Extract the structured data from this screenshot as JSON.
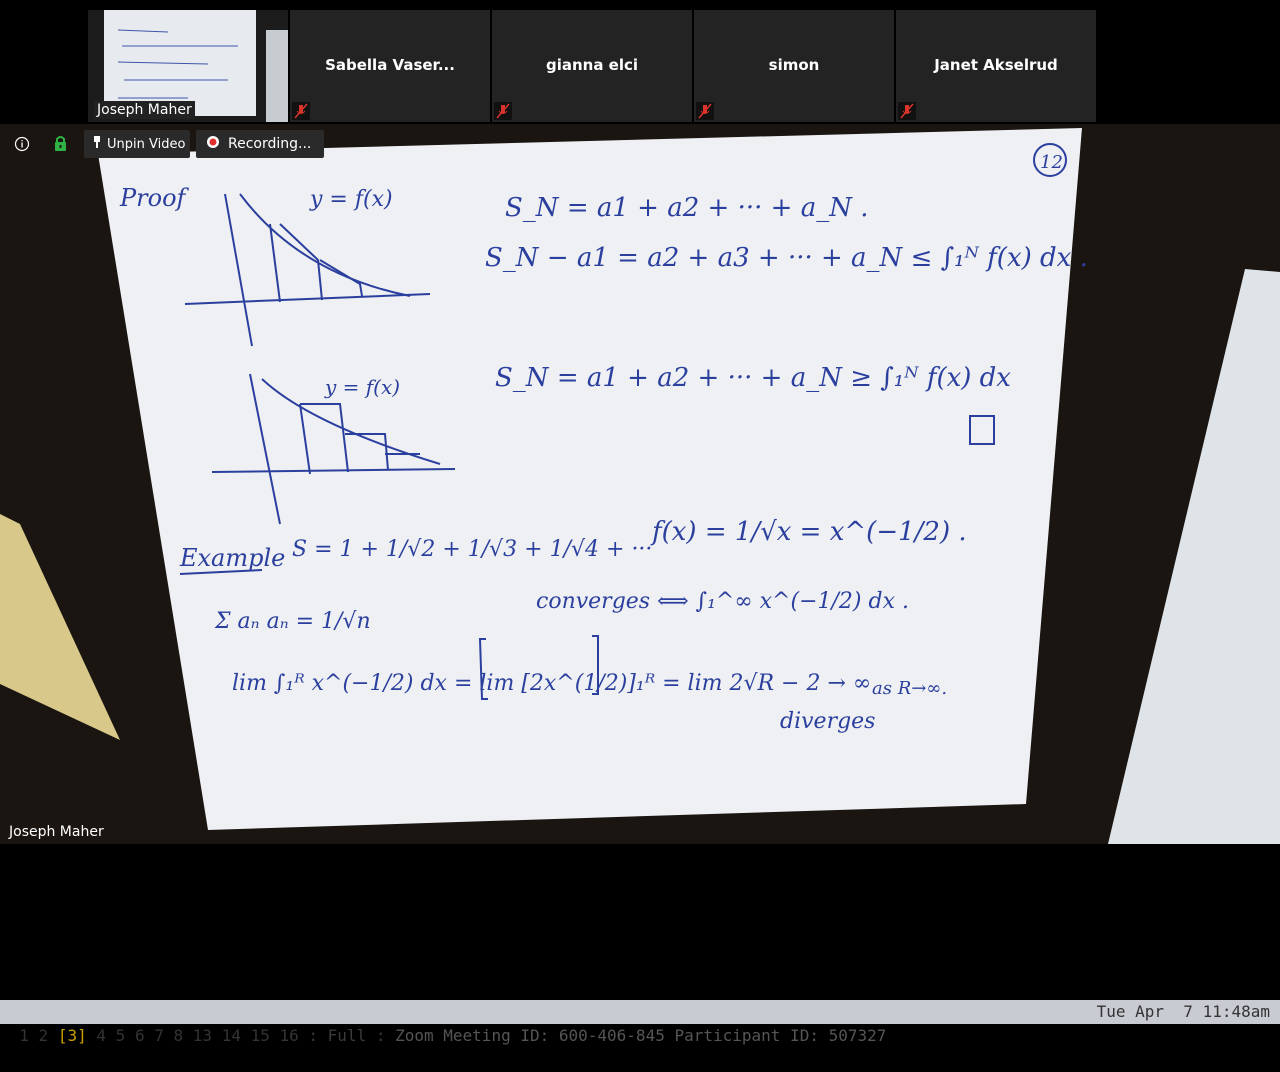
{
  "participants": [
    {
      "name": "Joseph Maher",
      "muted": false,
      "self": true
    },
    {
      "name": "Sabella Vaser...",
      "muted": true
    },
    {
      "name": "gianna elci",
      "muted": true
    },
    {
      "name": "simon",
      "muted": true
    },
    {
      "name": "Janet Akselrud",
      "muted": true
    }
  ],
  "toolbar": {
    "unpin_label": "Unpin Video",
    "recording_label": "Recording..."
  },
  "video": {
    "speaker_name": "Joseph Maher",
    "page_number": "12",
    "whiteboard": {
      "proof_label": "Proof",
      "sn_line1": "S_N = a1 + a2 + ··· + a_N .",
      "sn_line2": "S_N − a1 = a2 + a3 + ··· + a_N ≤ ∫₁ᴺ f(x) dx .",
      "sn_line3": "S_N = a1 + a2 + ··· + a_N ≥ ∫₁ᴺ f(x) dx",
      "graph_label1": "y = f(x)",
      "graph_label2": "y = f(x)",
      "example_label": "Example",
      "example_series": "S = 1 + 1/√2 + 1/√3 + 1/√4 + ···",
      "example_f": "f(x) = 1/√x = x^(−1/2) .",
      "sum_expr": "Σ aₙ   aₙ = 1/√n",
      "converges": "converges ⟺ ∫₁^∞ x^(−1/2) dx .",
      "limit_expr": "lim ∫₁ᴿ x^(−1/2) dx = lim [2x^(1/2)]₁ᴿ = lim 2√R − 2 → ∞",
      "as_r": "as R→∞.",
      "diverges": "diverges"
    }
  },
  "status_bar": {
    "workspaces": [
      "1",
      "2",
      "[3]",
      "4",
      "5",
      "6",
      "7",
      "8",
      "13",
      "14",
      "15",
      "16"
    ],
    "active_workspace": "[3]",
    "layout": ": Full :",
    "window_title": "Zoom Meeting ID: 600-406-845 Participant ID: 507327",
    "clock": "Tue Apr  7 11:48am"
  },
  "colors": {
    "tile_bg": "#232323",
    "mute_red": "#d9342b",
    "ink_blue": "#2b3f9e",
    "paper": "#f1f3f5",
    "statusbar_bg": "#c8ccd2",
    "active_ws": "#c8a000"
  }
}
